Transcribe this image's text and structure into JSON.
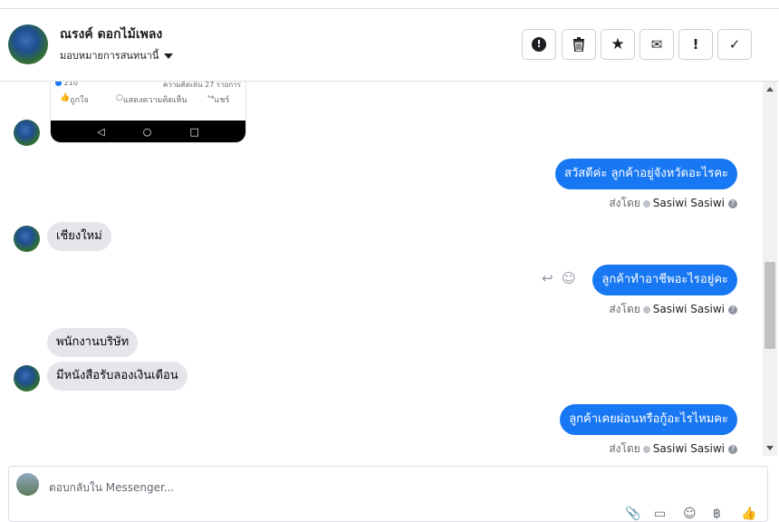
{
  "header": {
    "contact_name": "ณรงค์ ดอกไม้เพลง",
    "assign_label": "มอบหมายการสนทนานี้",
    "toolbar": {
      "spam_icon": "!",
      "delete_icon": "🗑",
      "star_icon": "★",
      "unread_icon": "✉",
      "follow_up_icon": "!",
      "done_icon": "✓"
    }
  },
  "shared_post": {
    "reaction_count": "210",
    "comments_count": "ความคิดเห็น 27 รายการ",
    "like": "ถูกใจ",
    "comment": "แสดงความคิดเห็น",
    "share": "แชร์"
  },
  "messages": [
    {
      "direction": "out",
      "text": "สวัสดีค่ะ ลูกค้าอยู่จังหวัดอะไรคะ",
      "sent_by_prefix": "ส่งโดย",
      "sent_by_name": "Sasiwi Sasiwi"
    },
    {
      "direction": "in",
      "text": "เชียงใหม่"
    },
    {
      "direction": "out",
      "text": "ลูกค้าทำอาชีพอะไรอยู่คะ",
      "sent_by_prefix": "ส่งโดย",
      "sent_by_name": "Sasiwi Sasiwi"
    },
    {
      "direction": "in",
      "text": "พนักงานบริษัท"
    },
    {
      "direction": "in",
      "text": "มีหนังสือรับลองเงินเดือน"
    },
    {
      "direction": "out",
      "text": "ลูกค้าเคยผ่อนหรือกู้อะไรไหมคะ",
      "sent_by_prefix": "ส่งโดย",
      "sent_by_name": "Sasiwi Sasiwi"
    }
  ],
  "composer": {
    "placeholder": "ตอบกลับใน Messenger..."
  },
  "colors": {
    "accent": "#1877f2",
    "incoming_bubble": "#e4e6eb"
  }
}
